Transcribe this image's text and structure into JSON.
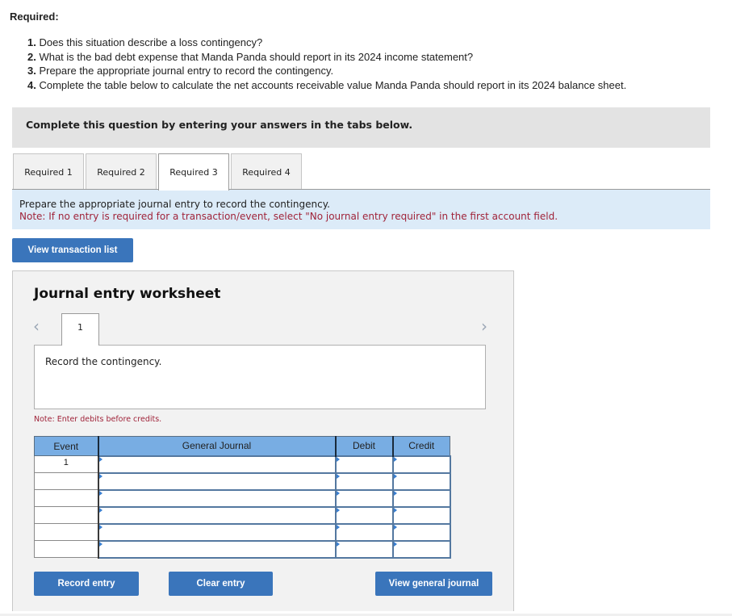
{
  "required": {
    "title": "Required:",
    "items": [
      {
        "num": "1.",
        "text": " Does this situation describe a loss contingency?"
      },
      {
        "num": "2.",
        "text": " What is the bad debt expense that Manda Panda should report in its 2024 income statement?"
      },
      {
        "num": "3.",
        "text": " Prepare the appropriate journal entry to record the contingency."
      },
      {
        "num": "4.",
        "text": " Complete the table below to calculate the net accounts receivable value Manda Panda should report in its 2024 balance sheet."
      }
    ]
  },
  "instructions": "Complete this question by entering your answers in the tabs below.",
  "tabs": [
    {
      "label": "Required 1",
      "active": false
    },
    {
      "label": "Required 2",
      "active": false
    },
    {
      "label": "Required 3",
      "active": true
    },
    {
      "label": "Required 4",
      "active": false
    }
  ],
  "prompt": {
    "text": "Prepare the appropriate journal entry to record the contingency.",
    "note": "Note: If no entry is required for a transaction/event, select \"No journal entry required\" in the first account field."
  },
  "buttons": {
    "view_transaction_list": "View transaction list",
    "record_entry": "Record entry",
    "clear_entry": "Clear entry",
    "view_general_journal": "View general journal"
  },
  "worksheet": {
    "title": "Journal entry worksheet",
    "nav_prev_icon": "chevron-left",
    "nav_next_icon": "chevron-right",
    "entry_tab": "1",
    "description": "Record the contingency.",
    "note": "Note: Enter debits before credits.",
    "table": {
      "headers": [
        "Event",
        "General Journal",
        "Debit",
        "Credit"
      ],
      "rows": [
        {
          "event": "1",
          "account": "",
          "debit": "",
          "credit": ""
        },
        {
          "event": "",
          "account": "",
          "debit": "",
          "credit": ""
        },
        {
          "event": "",
          "account": "",
          "debit": "",
          "credit": ""
        },
        {
          "event": "",
          "account": "",
          "debit": "",
          "credit": ""
        },
        {
          "event": "",
          "account": "",
          "debit": "",
          "credit": ""
        },
        {
          "event": "",
          "account": "",
          "debit": "",
          "credit": ""
        }
      ]
    }
  }
}
